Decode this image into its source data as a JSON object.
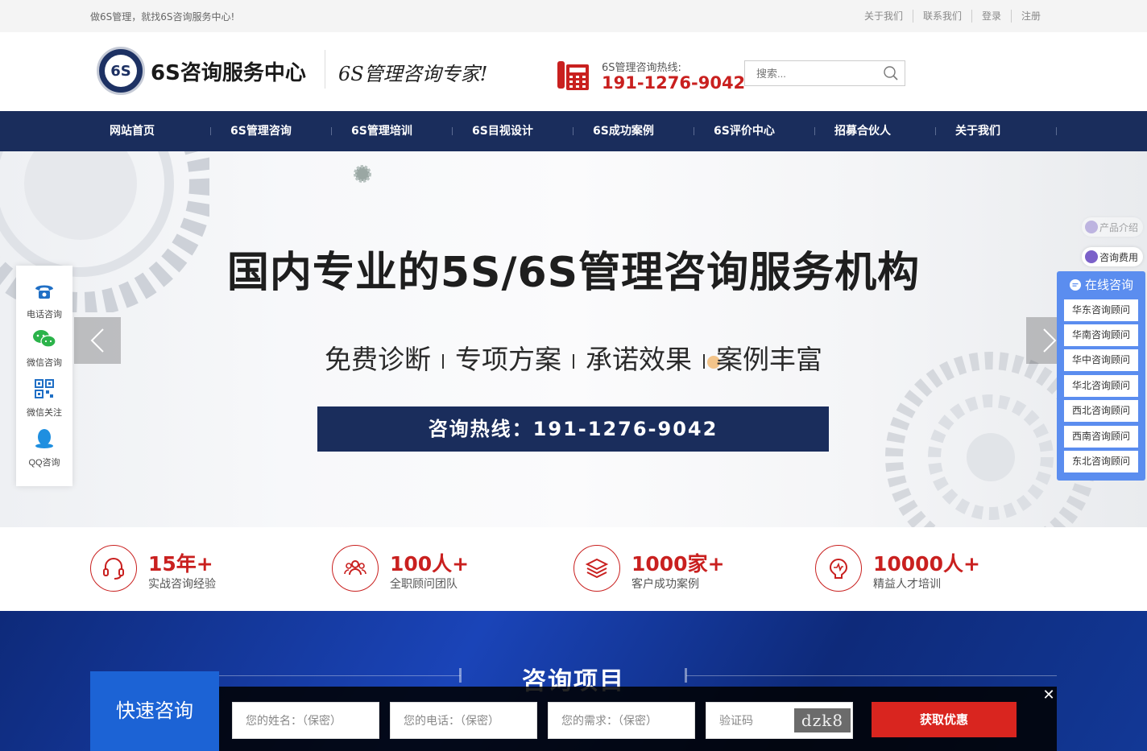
{
  "topbar": {
    "slogan": "做6S管理，就找6S咨询服务中心!",
    "links": [
      "关于我们",
      "联系我们",
      "登录",
      "注册"
    ]
  },
  "header": {
    "logo_badge": "6S",
    "logo_text": "6S咨询服务中心",
    "slogan": "6S管理咨询专家!",
    "hotline_label": "6S管理咨询热线:",
    "hotline_number": "191-1276-9042",
    "search_placeholder": "搜索..."
  },
  "nav": {
    "items": [
      "网站首页",
      "6S管理咨询",
      "6S管理培训",
      "6S目视设计",
      "6S成功案例",
      "6S评价中心",
      "招募合伙人",
      "关于我们"
    ]
  },
  "banner": {
    "title": "国内专业的5S/6S管理咨询服务机构",
    "features": [
      "免费诊断",
      "专项方案",
      "承诺效果",
      "案例丰富"
    ],
    "hotline": "咨询热线：191-1276-9042"
  },
  "left_float": {
    "items": [
      {
        "label": "电话咨询"
      },
      {
        "label": "微信咨询"
      },
      {
        "label": "微信关注"
      },
      {
        "label": "QQ咨询"
      }
    ]
  },
  "right_float": {
    "mini": [
      "产品介绍",
      "咨询费用"
    ],
    "panel_title": "在线咨询",
    "consultants": [
      "华东咨询顾问",
      "华南咨询顾问",
      "华中咨询顾问",
      "华北咨询顾问",
      "西北咨询顾问",
      "西南咨询顾问",
      "东北咨询顾问"
    ]
  },
  "stats": [
    {
      "number": "15年+",
      "label": "实战咨询经验"
    },
    {
      "number": "100人+",
      "label": "全职顾问团队"
    },
    {
      "number": "1000家+",
      "label": "客户成功案例"
    },
    {
      "number": "10000人+",
      "label": "精益人才培训"
    }
  ],
  "section": {
    "title": "咨询项目"
  },
  "quick_form": {
    "tab_label": "快速咨询",
    "name_placeholder": "您的姓名：（保密）",
    "phone_placeholder": "您的电话：（保密）",
    "need_placeholder": "您的需求：（保密）",
    "captcha_placeholder": "验证码",
    "captcha_text": "dzk8",
    "submit_label": "获取优惠",
    "close_label": "✕"
  },
  "colors": {
    "brand_navy": "#1a2d5c",
    "accent_red": "#c9201f",
    "panel_blue": "#5b8def",
    "quick_blue": "#1c63d5"
  }
}
